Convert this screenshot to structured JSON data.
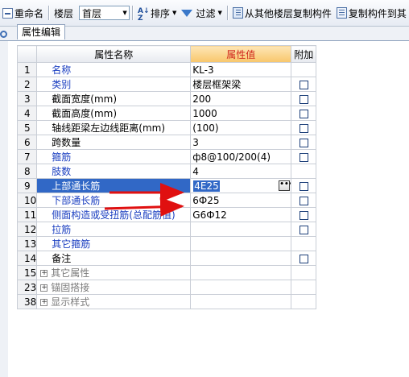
{
  "toolbar": {
    "rename_label": "重命名",
    "floor_label": "楼层",
    "floor_value": "首层",
    "sort_label": "排序",
    "filter_label": "过滤",
    "copy_from_floor_label": "从其他楼层复制构件",
    "copy_to_label": "复制构件到其"
  },
  "tab": {
    "label": "属性编辑"
  },
  "grid": {
    "headers": {
      "name": "属性名称",
      "value": "属性值",
      "extra": "附加"
    },
    "rows": [
      {
        "num": "1",
        "name": "名称",
        "value": "KL-3"
      },
      {
        "num": "2",
        "name": "类别",
        "value": "楼层框架梁"
      },
      {
        "num": "3",
        "name": "截面宽度(mm)",
        "value": "200"
      },
      {
        "num": "4",
        "name": "截面高度(mm)",
        "value": "1000"
      },
      {
        "num": "5",
        "name": "轴线距梁左边线距离(mm)",
        "value": "(100)"
      },
      {
        "num": "6",
        "name": "跨数量",
        "value": "3"
      },
      {
        "num": "7",
        "name": "箍筋",
        "value": "ф8@100/200(4)"
      },
      {
        "num": "8",
        "name": "肢数",
        "value": "4"
      },
      {
        "num": "9",
        "name": "上部通长筋",
        "value": "4E25"
      },
      {
        "num": "10",
        "name": "下部通长筋",
        "value": "6Ф25"
      },
      {
        "num": "11",
        "name": "侧面构造或受扭筋(总配筋值)",
        "value": "G6Ф12"
      },
      {
        "num": "12",
        "name": "拉筋",
        "value": ""
      },
      {
        "num": "13",
        "name": "其它箍筋",
        "value": ""
      },
      {
        "num": "14",
        "name": "备注",
        "value": ""
      },
      {
        "num": "15",
        "name": "其它属性",
        "value": ""
      },
      {
        "num": "23",
        "name": "锚固搭接",
        "value": ""
      },
      {
        "num": "38",
        "name": "显示样式",
        "value": ""
      }
    ]
  },
  "colors": {
    "link_blue": "#1a3ec0",
    "selection": "#3168c6",
    "arrow_red": "#e01010",
    "header_value": "#d0271d"
  }
}
